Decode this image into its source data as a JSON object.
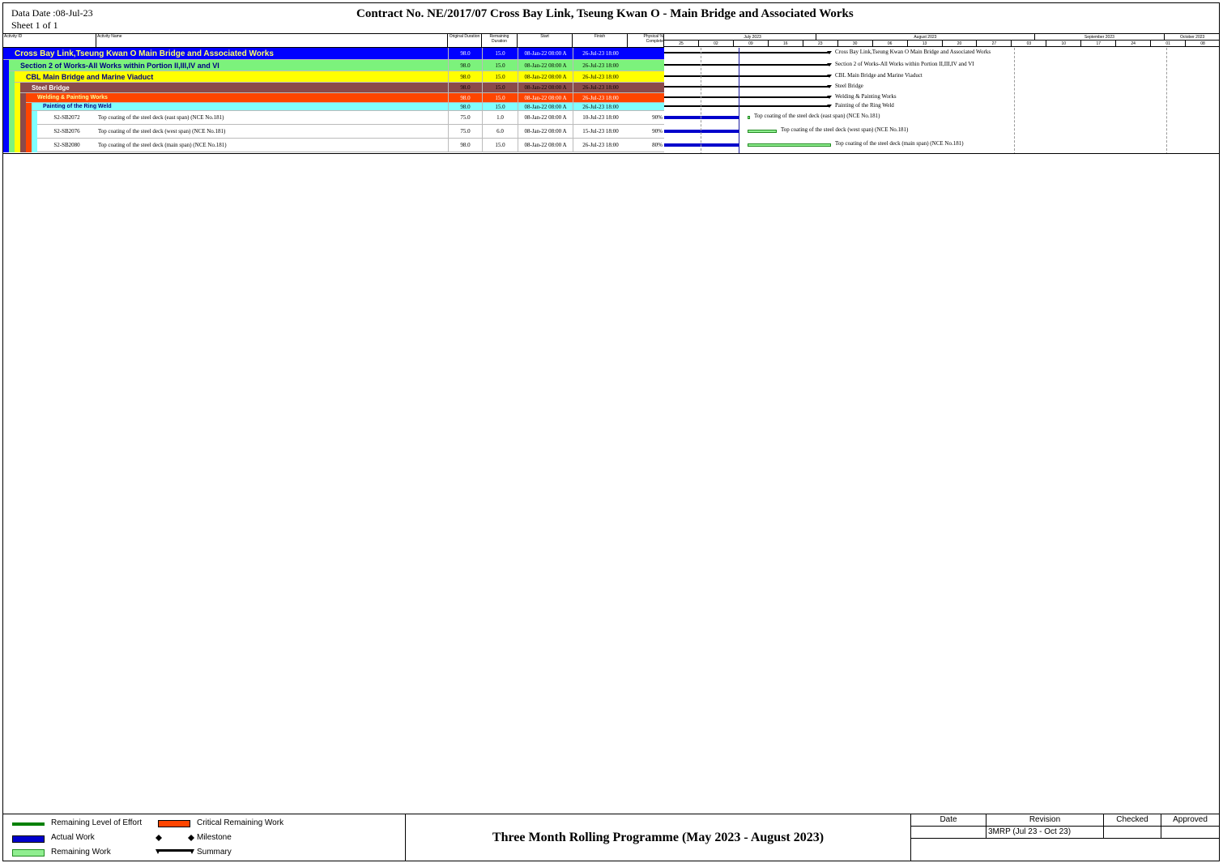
{
  "header": {
    "data_date": "Data Date :08-Jul-23",
    "sheet": "Sheet 1 of 1",
    "title": "Contract  No. NE/2017/07  Cross Bay Link, Tseung Kwan O - Main Bridge and Associated Works"
  },
  "columns": {
    "activity_id": "Activity ID",
    "activity_name": "Activity Name",
    "original_duration": "Original Duration",
    "remaining_duration": "Remaining Duration",
    "start": "Start",
    "finish": "Finish",
    "physical_complete": "Physical % Complete"
  },
  "timeline": {
    "months": [
      "July 2023",
      "August 2023",
      "September 2023",
      "October 2023"
    ],
    "weeks": [
      "25",
      "02",
      "09",
      "16",
      "23",
      "30",
      "06",
      "13",
      "20",
      "27",
      "03",
      "10",
      "17",
      "24",
      "01",
      "08"
    ]
  },
  "rows": [
    {
      "id": "",
      "name": "Cross Bay Link,Tseung Kwan O Main Bridge and Associated Works",
      "orig": "98.0",
      "rem": "15.0",
      "start": "08-Jan-22 08:00 A",
      "finish": "26-Jul-23 18:00",
      "pct": "",
      "bar_label": "Cross Bay Link,Tseung Kwan O Main Bridge and Associated Works",
      "color": "#0000ff",
      "text_color": "#ffff66"
    },
    {
      "id": "",
      "name": "Section 2 of Works-All Works within Portion II,III,IV and VI",
      "orig": "98.0",
      "rem": "15.0",
      "start": "08-Jan-22 08:00 A",
      "finish": "26-Jul-23 18:00",
      "pct": "",
      "bar_label": "Section 2 of Works-All Works within Portion II,III,IV and VI",
      "color": "#7cf27c",
      "text_color": "#000080"
    },
    {
      "id": "",
      "name": "CBL Main Bridge and Marine Viaduct",
      "orig": "98.0",
      "rem": "15.0",
      "start": "08-Jan-22 08:00 A",
      "finish": "26-Jul-23 18:00",
      "pct": "",
      "bar_label": "CBL Main Bridge and Marine Viaduct",
      "color": "#ffff00",
      "text_color": "#000080"
    },
    {
      "id": "",
      "name": "Steel Bridge",
      "orig": "98.0",
      "rem": "15.0",
      "start": "08-Jan-22 08:00 A",
      "finish": "26-Jul-23 18:00",
      "pct": "",
      "bar_label": "Steel Bridge",
      "color": "#8b4a4a",
      "text_color": "#ffffff"
    },
    {
      "id": "",
      "name": "Welding & Painting Works",
      "orig": "98.0",
      "rem": "15.0",
      "start": "08-Jan-22 08:00 A",
      "finish": "26-Jul-23 18:00",
      "pct": "",
      "bar_label": "Welding & Painting Works",
      "color": "#ff4500",
      "text_color": "#ffff99"
    },
    {
      "id": "",
      "name": "Painting of the Ring Weld",
      "orig": "98.0",
      "rem": "15.0",
      "start": "08-Jan-22 08:00 A",
      "finish": "26-Jul-23 18:00",
      "pct": "",
      "bar_label": "Painting of the Ring Weld",
      "color": "#80ffff",
      "text_color": "#000080"
    },
    {
      "id": "S2-SB2072",
      "name": "Top coating of the steel deck (east span) (NCE No.181)",
      "orig": "75.0",
      "rem": "1.0",
      "start": "08-Jan-22 08:00 A",
      "finish": "10-Jul-23 18:00",
      "pct": "90%",
      "bar_label": "Top coating of the steel deck (east span) (NCE No.181)",
      "color": "#ffffff",
      "text_color": "#000000"
    },
    {
      "id": "S2-SB2076",
      "name": "Top coating of the steel deck (west span) (NCE No.181)",
      "orig": "75.0",
      "rem": "6.0",
      "start": "08-Jan-22 08:00 A",
      "finish": "15-Jul-23 18:00",
      "pct": "90%",
      "bar_label": "Top coating of the steel deck (west span) (NCE No.181)",
      "color": "#ffffff",
      "text_color": "#000000"
    },
    {
      "id": "S2-SB2080",
      "name": "Top coating of the steel deck (main span) (NCE No.181)",
      "orig": "98.0",
      "rem": "15.0",
      "start": "08-Jan-22 08:00 A",
      "finish": "26-Jul-23 18:00",
      "pct": "80%",
      "bar_label": "Top coating of the steel deck (main span) (NCE No.181)",
      "color": "#ffffff",
      "text_color": "#000000"
    }
  ],
  "legend": {
    "level_of_effort": "Remaining Level of Effort",
    "actual_work": "Actual Work",
    "remaining_work": "Remaining Work",
    "critical_remaining": "Critical Remaining Work",
    "milestone": "Milestone",
    "summary": "Summary"
  },
  "footer": {
    "title": "Three Month Rolling Programme (May 2023 - August 2023)",
    "rev_headers": {
      "date": "Date",
      "revision": "Revision",
      "checked": "Checked",
      "approved": "Approved"
    },
    "rev_values": {
      "date": "",
      "revision": "3MRP (Jul 23 - Oct 23)",
      "checked": "",
      "approved": ""
    }
  },
  "colors": {
    "actual": "#0000cc",
    "remaining": "#90ee90",
    "critical": "#ff4500",
    "level_of_effort": "#008000",
    "summary": "#000000"
  }
}
